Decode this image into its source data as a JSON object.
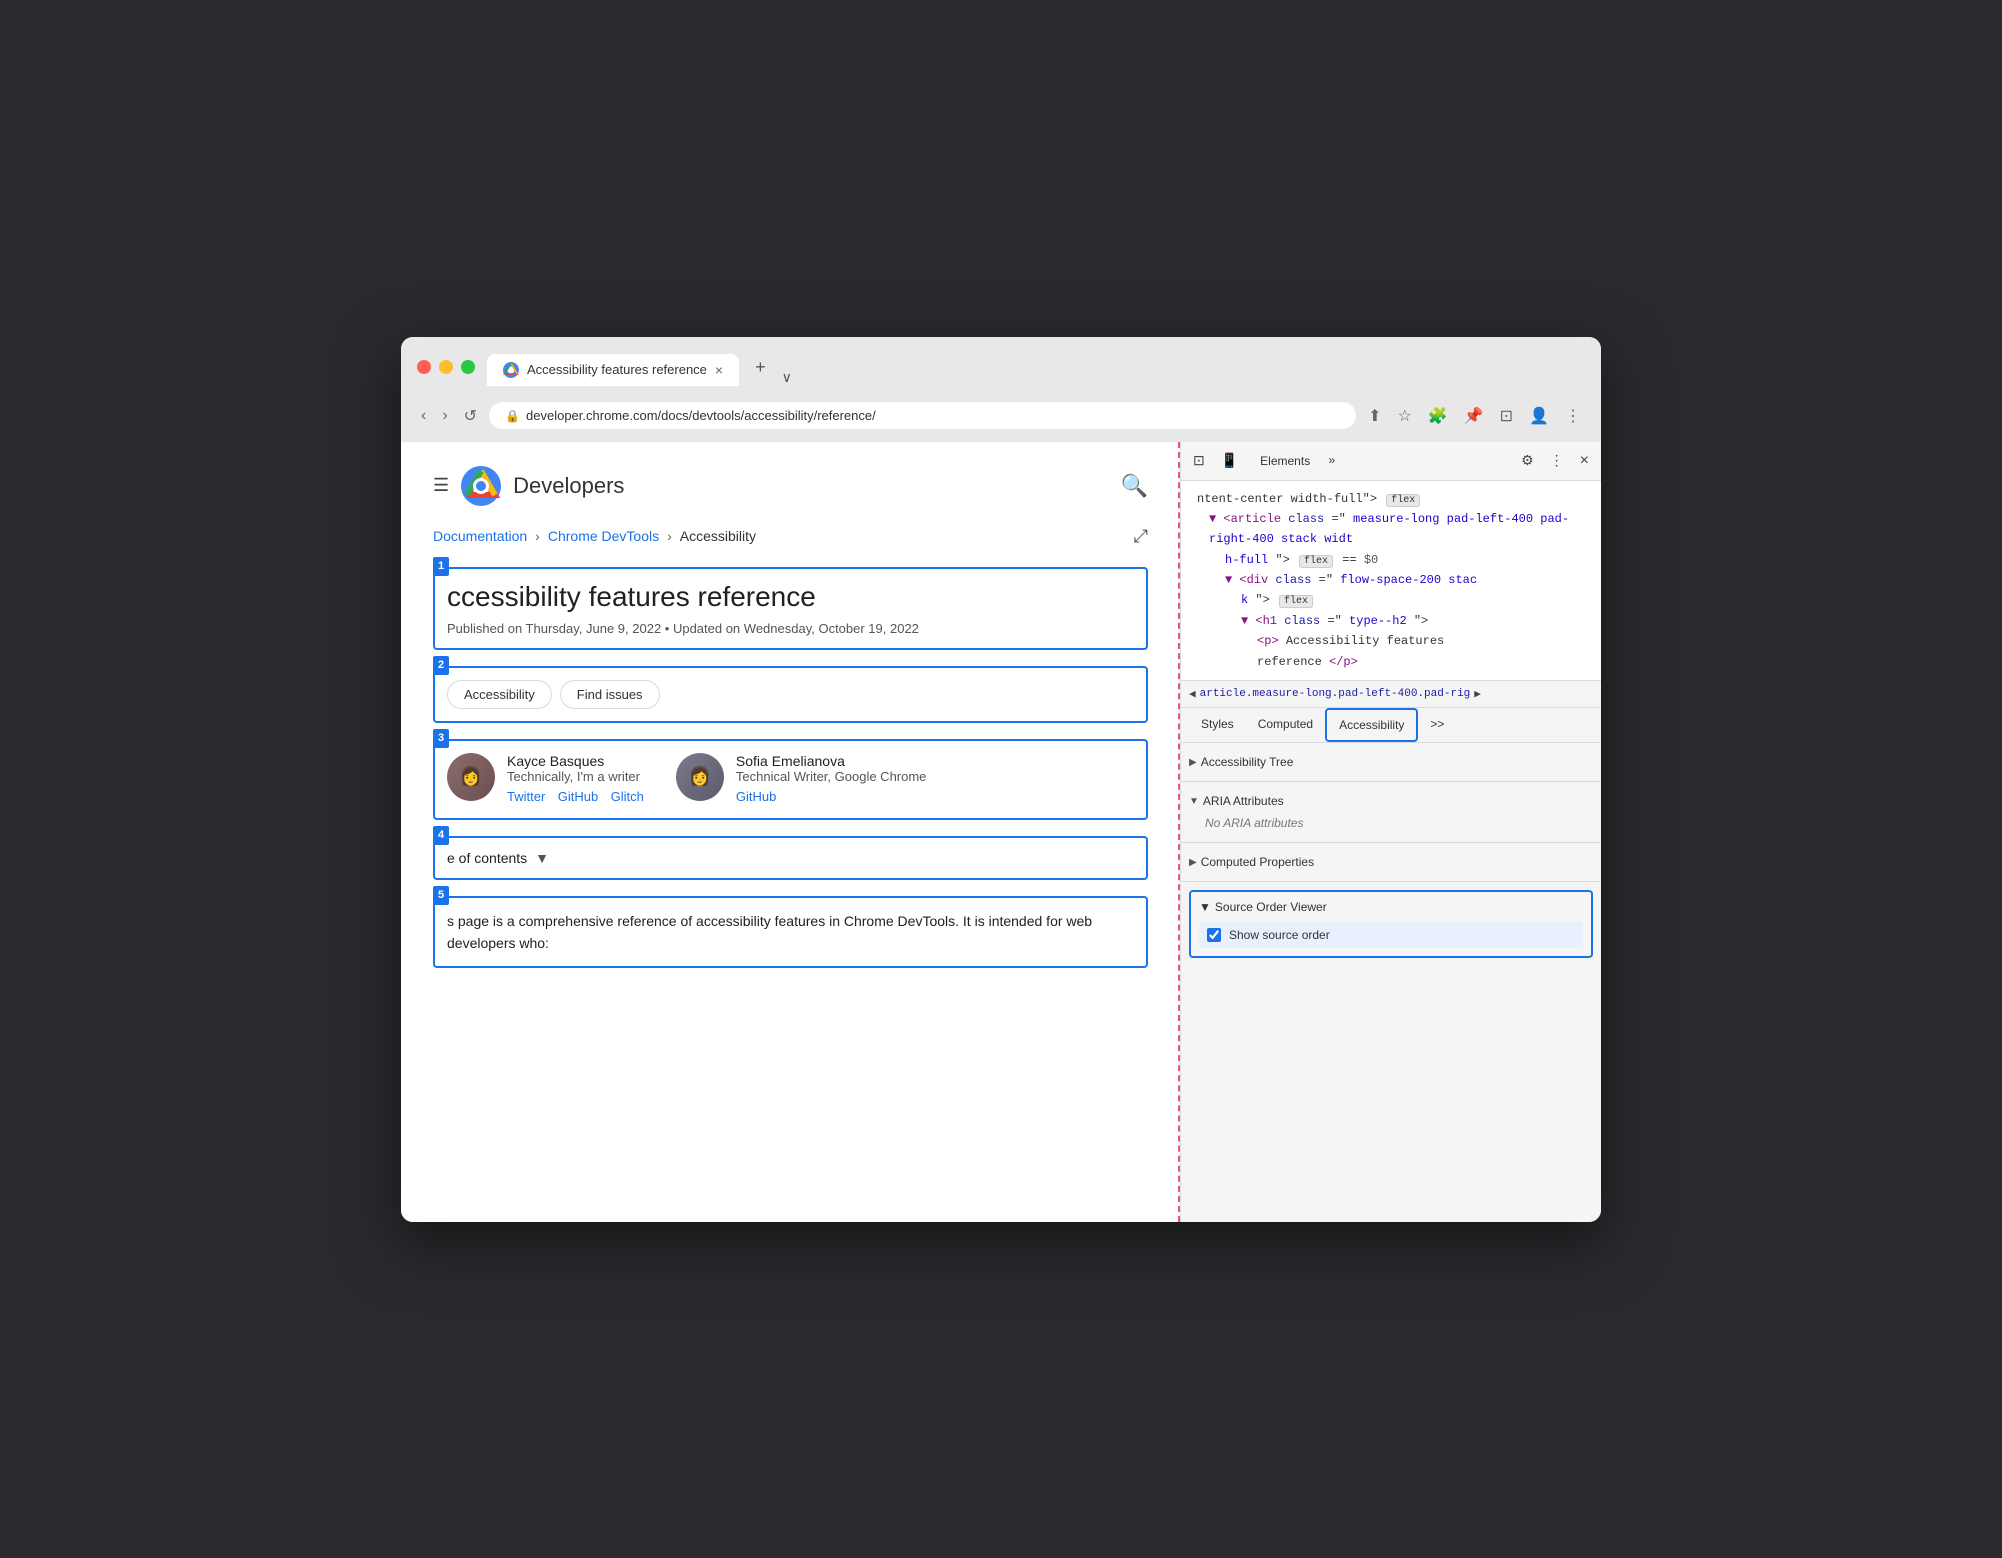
{
  "browser": {
    "traffic_lights": [
      "red",
      "yellow",
      "green"
    ],
    "tab": {
      "title": "Accessibility features reference",
      "close_label": "×"
    },
    "new_tab_label": "+",
    "tab_chevron": "∨",
    "nav": {
      "back_label": "‹",
      "forward_label": "›",
      "reload_label": "↺",
      "lock_icon": "🔒",
      "url": "developer.chrome.com/docs/devtools/accessibility/reference/",
      "share_label": "⬆",
      "star_label": "☆",
      "ext_label": "🧩",
      "pin_label": "📌",
      "window_label": "⊡",
      "profile_label": "👤",
      "menu_label": "⋮"
    }
  },
  "page": {
    "hamburger_label": "☰",
    "brand_name": "Developers",
    "search_label": "🔍",
    "breadcrumb": {
      "doc_link": "Documentation",
      "devtools_link": "Chrome DevTools",
      "current": "Accessibility"
    },
    "share_label": "⤢",
    "boxes": {
      "box1": {
        "number": "1",
        "heading": "ccessibility features reference",
        "pub_date": "Published on Thursday, June 9, 2022 • Updated on Wednesday, October 19, 2022"
      },
      "box2": {
        "number": "2",
        "tag1": "Accessibility",
        "tag2": "Find issues"
      },
      "box3": {
        "number": "3",
        "author1": {
          "name": "Kayce Basques",
          "role": "Technically, I'm a writer",
          "links": [
            "Twitter",
            "GitHub",
            "Glitch"
          ]
        },
        "author2": {
          "name": "Sofia Emelianova",
          "role": "Technical Writer, Google Chrome",
          "links": [
            "GitHub"
          ]
        }
      },
      "box4": {
        "number": "4",
        "text": "e of contents",
        "dropdown": "▼"
      },
      "box5": {
        "number": "5",
        "text": "s page is a comprehensive reference of accessibility features in Chrome DevTools. It is intended for web developers who:"
      }
    }
  },
  "devtools": {
    "toolbar": {
      "inspect_label": "⊡",
      "device_label": "📱",
      "elements_tab": "Elements",
      "more_label": "»",
      "gear_label": "⚙",
      "dots_label": "⋮",
      "close_label": "×"
    },
    "html": {
      "line1": "ntent-center width-full\">",
      "badge1": "flex",
      "line2_start": "<article class=\"measure-long pad-",
      "line2_cont": "left-400 pad-right-400 stack widt",
      "line2_end": "h-full\">",
      "badge2": "flex",
      "equals": "==",
      "dollar": "$0",
      "line3": "<div class=\"flow-space-200 stac",
      "line3_end": "k\">",
      "badge3": "flex",
      "line4": "<h1 class=\"type--h2\">",
      "line5": "<p>Accessibility features",
      "line6": "reference</p>"
    },
    "breadcrumb": "article.measure-long.pad-left-400.pad-rig",
    "tabs": {
      "styles": "Styles",
      "computed": "Computed",
      "accessibility": "Accessibility",
      "more": ">>"
    },
    "sections": {
      "accessibility_tree": "Accessibility Tree",
      "aria_attributes": "ARIA Attributes",
      "aria_empty": "No ARIA attributes",
      "computed_properties": "Computed Properties"
    },
    "sov": {
      "header": "Source Order Viewer",
      "checkbox_label": "Show source order",
      "checked": true
    }
  }
}
